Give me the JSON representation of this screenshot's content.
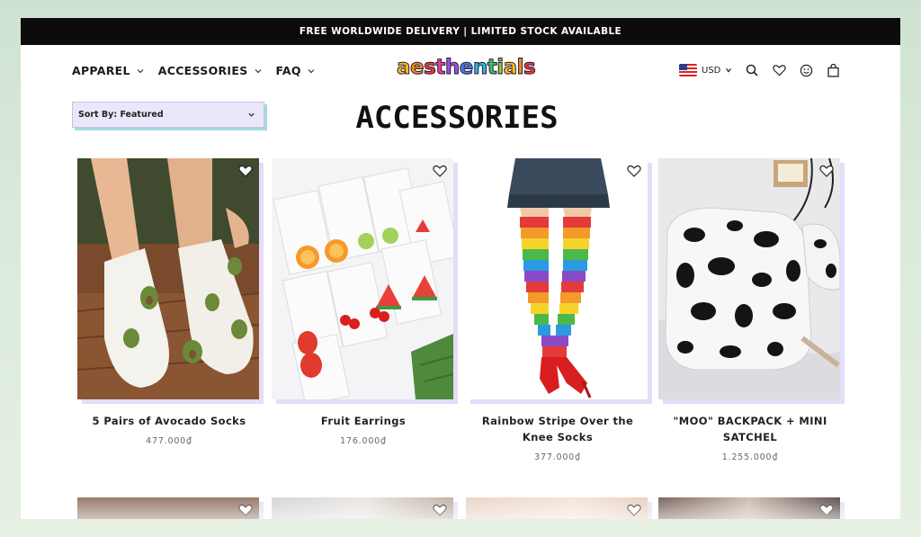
{
  "announcement": "FREE WORLDWIDE DELIVERY | LIMITED STOCK AVAILABLE",
  "nav": [
    {
      "label": "APPAREL"
    },
    {
      "label": "ACCESSORIES"
    },
    {
      "label": "FAQ"
    }
  ],
  "logo": {
    "text": "aesthentials",
    "letters": [
      "a",
      "e",
      "s",
      "t",
      "h",
      "e",
      "n",
      "t",
      "i",
      "a",
      "l",
      "s"
    ],
    "colors": [
      "#f6c01a",
      "#f08a1c",
      "#ee3d35",
      "#e8409a",
      "#9b52d6",
      "#4a7ae8",
      "#2fb6d8",
      "#3fbf6a",
      "#8ccc2b",
      "#f6c01a",
      "#f08a1c",
      "#ee3d35"
    ]
  },
  "currency": {
    "code": "USD",
    "flag_icon": "us-flag-icon"
  },
  "icons": [
    "search-icon",
    "heart-icon",
    "account-icon",
    "cart-icon"
  ],
  "sort": {
    "label": "Sort By: Featured"
  },
  "page_title": "ACCESSORIES",
  "products": [
    {
      "name": "5 Pairs of Avocado Socks",
      "price": "477.000₫"
    },
    {
      "name": "Fruit Earrings",
      "price": "176.000₫"
    },
    {
      "name": "Rainbow Stripe Over the Knee Socks",
      "price": "377.000₫"
    },
    {
      "name": "\"MOO\" BACKPACK + MINI SATCHEL",
      "price": "1.255.000₫"
    }
  ],
  "colors": {
    "sort_bg": "#ece6fa",
    "card_shadow": "#e5dcf8",
    "sort_shadow": "#a6d9dc"
  }
}
